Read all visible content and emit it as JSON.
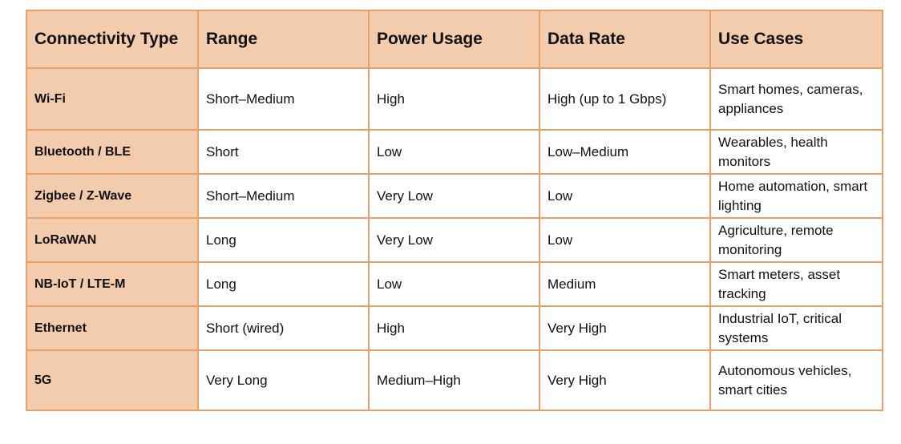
{
  "table": {
    "headers": [
      "Connectivity Type",
      "Range",
      "Power Usage",
      "Data Rate",
      "Use Cases"
    ],
    "rows": [
      [
        "Wi-Fi",
        "Short–Medium",
        "High",
        "High (up to 1 Gbps)",
        "Smart homes, cameras, appliances"
      ],
      [
        "Bluetooth / BLE",
        "Short",
        "Low",
        "Low–Medium",
        "Wearables, health monitors"
      ],
      [
        "Zigbee / Z-Wave",
        "Short–Medium",
        "Very Low",
        "Low",
        "Home automation, smart lighting"
      ],
      [
        "LoRaWAN",
        "Long",
        "Very Low",
        "Low",
        "Agriculture, remote monitoring"
      ],
      [
        "NB-IoT / LTE-M",
        "Long",
        "Low",
        "Medium",
        "Smart meters, asset tracking"
      ],
      [
        "Ethernet",
        "Short (wired)",
        "High",
        "Very High",
        "Industrial IoT, critical systems"
      ],
      [
        "5G",
        "Very Long",
        "Medium–High",
        "Very High",
        "Autonomous vehicles, smart cities"
      ]
    ]
  },
  "colors": {
    "header_fill": "#f2ccad",
    "border": "#e8a06a",
    "body_fill": "#ffffff"
  }
}
